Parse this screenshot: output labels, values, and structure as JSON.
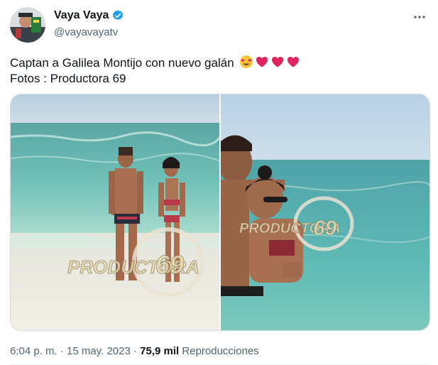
{
  "author": {
    "display_name": "Vaya Vaya",
    "handle": "@vayavayatv",
    "verified": true,
    "avatar_icon": "profile-photo"
  },
  "tweet": {
    "text_line1": "Captan a Galilea Montijo con nuevo galán",
    "text_line2": "Fotos : Productora 69",
    "emojis": [
      "heart-eyes",
      "red-heart",
      "red-heart",
      "red-heart"
    ]
  },
  "media": {
    "watermark_word": "PRODUCTORA",
    "watermark_number": "69",
    "photo_count": 2
  },
  "meta": {
    "time": "6:04 p. m.",
    "separator": "·",
    "date": "15 may. 2023",
    "views_count": "75,9 mil",
    "views_label": "Reproducciones"
  },
  "colors": {
    "verified": "#1d9bf0",
    "secondary_text": "#536471",
    "primary_text": "#0f1419",
    "heart": "#e0245e"
  },
  "icons": {
    "more": "more-horizontal-icon",
    "verified": "verified-badge-icon"
  }
}
